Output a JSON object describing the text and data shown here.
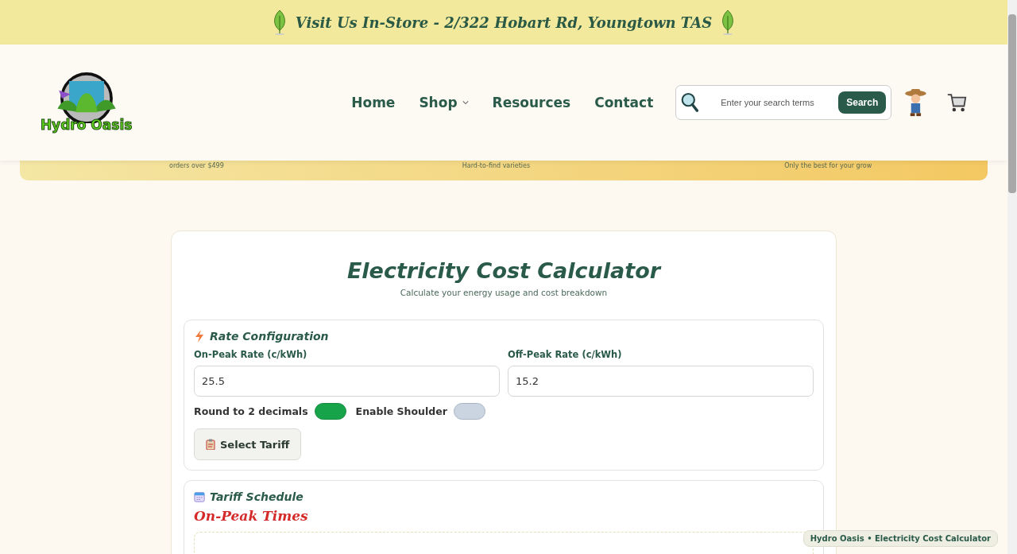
{
  "announcement": {
    "text": "Visit Us In-Store - 2/322 Hobart Rd, Youngtown TAS"
  },
  "logo": {
    "text": "Hydro Oasis"
  },
  "nav": [
    {
      "label": "Home",
      "dropdown": false
    },
    {
      "label": "Shop",
      "dropdown": true
    },
    {
      "label": "Resources",
      "dropdown": false
    },
    {
      "label": "Contact",
      "dropdown": false
    }
  ],
  "search": {
    "placeholder": "Enter your search terms",
    "button": "Search"
  },
  "perks": [
    {
      "text": "orders over $499"
    },
    {
      "text": "Hard-to-find varieties"
    },
    {
      "text": "Only the best for your grow"
    }
  ],
  "calculator": {
    "title": "Electricity Cost Calculator",
    "subtitle": "Calculate your energy usage and cost breakdown",
    "rate_section": {
      "title": "Rate Configuration",
      "fields": [
        {
          "label": "On-Peak Rate (c/kWh)",
          "value": "25.5"
        },
        {
          "label": "Off-Peak Rate (c/kWh)",
          "value": "15.2"
        }
      ],
      "toggles": [
        {
          "label": "Round to 2 decimals",
          "on": true
        },
        {
          "label": "Enable Shoulder",
          "on": false
        }
      ],
      "button": "Select Tariff"
    },
    "schedule_section": {
      "title": "Tariff Schedule",
      "subheading": "On-Peak Times"
    }
  },
  "footer_badge": "Hydro Oasis • Electricity Cost Calculator"
}
